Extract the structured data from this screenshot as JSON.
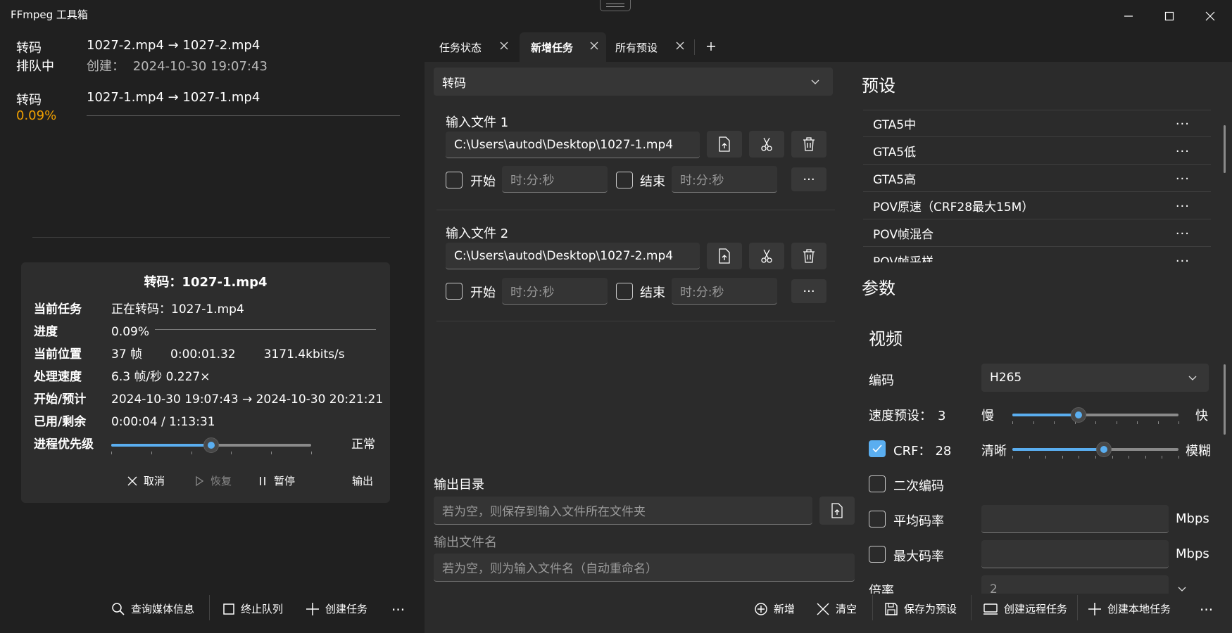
{
  "window": {
    "title": "FFmpeg 工具箱"
  },
  "queue": [
    {
      "type": "转码",
      "status": "排队中",
      "files": "1027-2.mp4 → 1027-2.mp4",
      "created_label": "创建：",
      "created": "2024-10-30 19:07:43"
    },
    {
      "type": "转码",
      "status": "0.09%",
      "files": "1027-1.mp4 → 1027-1.mp4",
      "progress": 0.0009
    }
  ],
  "detail": {
    "title": "转码：1027-1.mp4",
    "rows": [
      {
        "label": "当前任务",
        "value": "正在转码：1027-1.mp4"
      },
      {
        "label": "进度",
        "value": "0.09%"
      },
      {
        "label": "当前位置",
        "frames": "37 帧",
        "time": "0:00:01.32",
        "bitrate": "3171.4kbits/s"
      },
      {
        "label": "处理速度",
        "value": "6.3 帧/秒  0.227×"
      },
      {
        "label": "开始/预计",
        "value": "2024-10-30 19:07:43 → 2024-10-30 20:21:21"
      },
      {
        "label": "已用/剩余",
        "value": "0:00:04 / 1:13:31"
      },
      {
        "label": "进程优先级",
        "value": "正常",
        "level": 0.5
      }
    ],
    "actions": {
      "cancel": "取消",
      "resume": "恢复",
      "pause": "暂停",
      "output": "输出"
    }
  },
  "left_commands": {
    "media_info": "查询媒体信息",
    "stop_queue": "终止队列",
    "create_task": "创建任务",
    "more": "···"
  },
  "tabs": [
    {
      "label": "任务状态",
      "active": false
    },
    {
      "label": "新增任务",
      "active": true
    },
    {
      "label": "所有预设",
      "active": false
    }
  ],
  "task": {
    "type_select": "转码",
    "inputs": [
      {
        "label": "输入文件 1",
        "path": "C:\\Users\\autod\\Desktop\\1027-1.mp4",
        "start_label": "开始",
        "start_ph": "时:分:秒",
        "end_label": "结束",
        "end_ph": "时:分:秒"
      },
      {
        "label": "输入文件 2",
        "path": "C:\\Users\\autod\\Desktop\\1027-2.mp4",
        "start_label": "开始",
        "start_ph": "时:分:秒",
        "end_label": "结束",
        "end_ph": "时:分:秒"
      }
    ],
    "output_dir_label": "输出目录",
    "output_dir_ph": "若为空，则保存到输入文件所在文件夹",
    "output_name_label": "输出文件名",
    "output_name_ph": "若为空，则为输入文件名（自动重命名）"
  },
  "presets": {
    "heading": "预设",
    "items": [
      "GTA5中",
      "GTA5低",
      "GTA5高",
      "POV原速（CRF28最大15M）",
      "POV帧混合",
      "POV帧采样"
    ]
  },
  "params": {
    "heading": "参数",
    "video_heading": "视频",
    "codec_label": "编码",
    "codec_value": "H265",
    "speed_label": "速度预设：",
    "speed_value": "3",
    "speed_min": "慢",
    "speed_max": "快",
    "speed_level": 0.4,
    "crf_label": "CRF：",
    "crf_value": "28",
    "crf_min": "清晰",
    "crf_max": "模糊",
    "crf_level": 0.55,
    "two_pass": "二次编码",
    "avg_bitrate": "平均码率",
    "max_bitrate": "最大码率",
    "unit": "Mbps",
    "ratio_label": "倍率",
    "ratio_value": "2"
  },
  "bottom_commands": {
    "add": "新增",
    "clear": "清空",
    "save_preset": "保存为预设",
    "remote": "创建远程任务",
    "local": "创建本地任务",
    "more": "···"
  }
}
